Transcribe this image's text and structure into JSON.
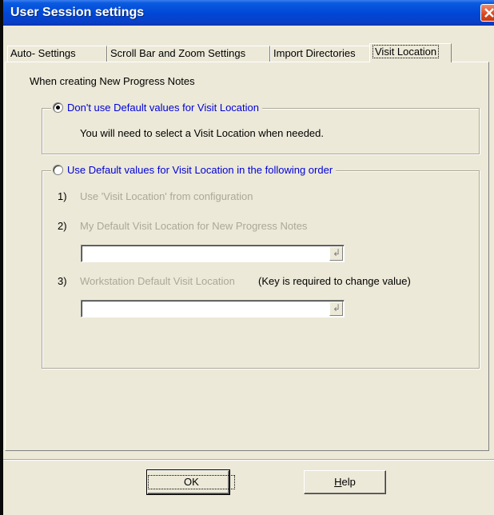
{
  "window": {
    "title": "User Session settings"
  },
  "tabs": [
    "Auto- Settings",
    "Scroll Bar and Zoom Settings",
    "Import Directories",
    "Visit Location"
  ],
  "active_tab": "Visit Location",
  "panel": {
    "heading": "When creating New Progress Notes",
    "option1": {
      "label": "Don't use Default values for Visit Location",
      "selected": true,
      "note": "You will need to select a Visit Location when needed."
    },
    "option2": {
      "label": "Use Default values for Visit Location in the following order",
      "selected": false,
      "items": [
        {
          "num": "1)",
          "text": "Use 'Visit Location' from configuration"
        },
        {
          "num": "2)",
          "text": "My Default Visit Location  for New Progress Notes"
        },
        {
          "num": "3)",
          "text": "Workstation Default Visit Location"
        }
      ],
      "key_note": "(Key is required to change value)",
      "combo1_value": "",
      "combo2_value": ""
    }
  },
  "buttons": {
    "ok": "OK",
    "help_underlined": "H",
    "help_rest": "elp"
  },
  "colors": {
    "title_bar": "#0046d5",
    "dialog_bg": "#ece9d8",
    "option_blue": "#0000d8",
    "disabled_text": "#aca899"
  }
}
